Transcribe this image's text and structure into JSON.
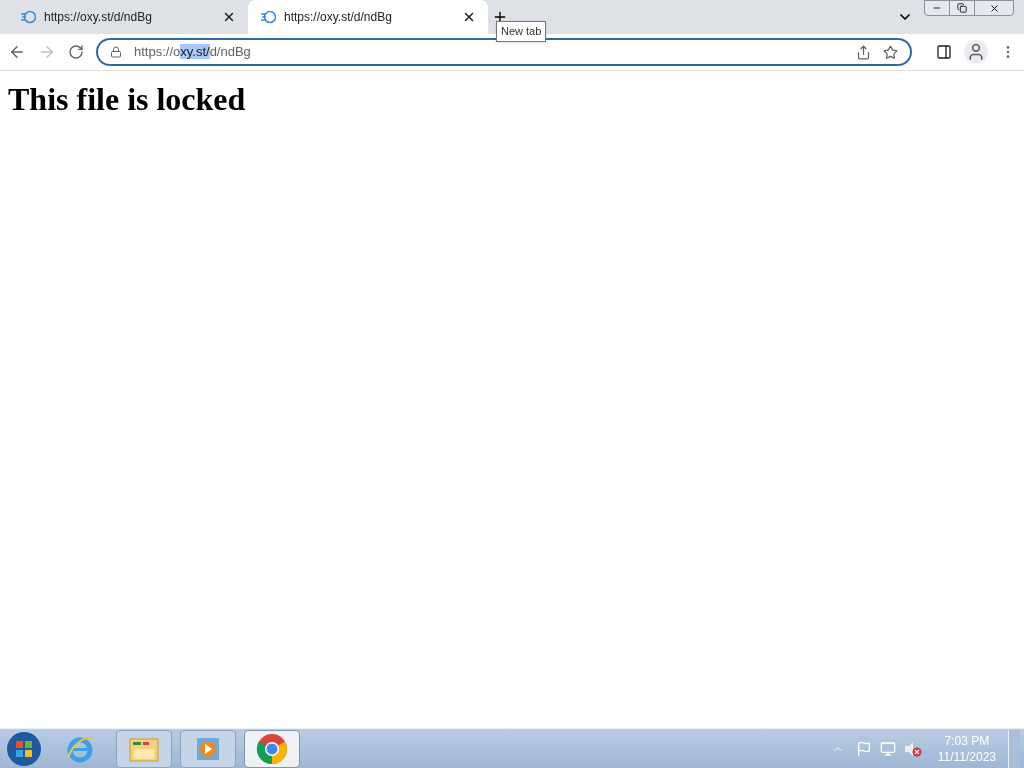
{
  "tabs": [
    {
      "title": "https://oxy.st/d/ndBg",
      "selected": false
    },
    {
      "title": "https://oxy.st/d/ndBg",
      "selected": true
    }
  ],
  "tooltip": "New tab",
  "address_bar": {
    "parts": [
      {
        "text": "https://o",
        "selected": false
      },
      {
        "text": "xy.st/",
        "selected": true
      },
      {
        "text": "d/ndBg",
        "selected": false
      }
    ]
  },
  "page": {
    "heading": "This file is locked"
  },
  "taskbar": {
    "apps": [
      {
        "kind": "ie",
        "selected": false
      },
      {
        "kind": "folder",
        "selected": false
      },
      {
        "kind": "media",
        "selected": false
      },
      {
        "kind": "chrome",
        "selected": true
      }
    ],
    "time": "7:03 PM",
    "date": "11/11/2023"
  }
}
